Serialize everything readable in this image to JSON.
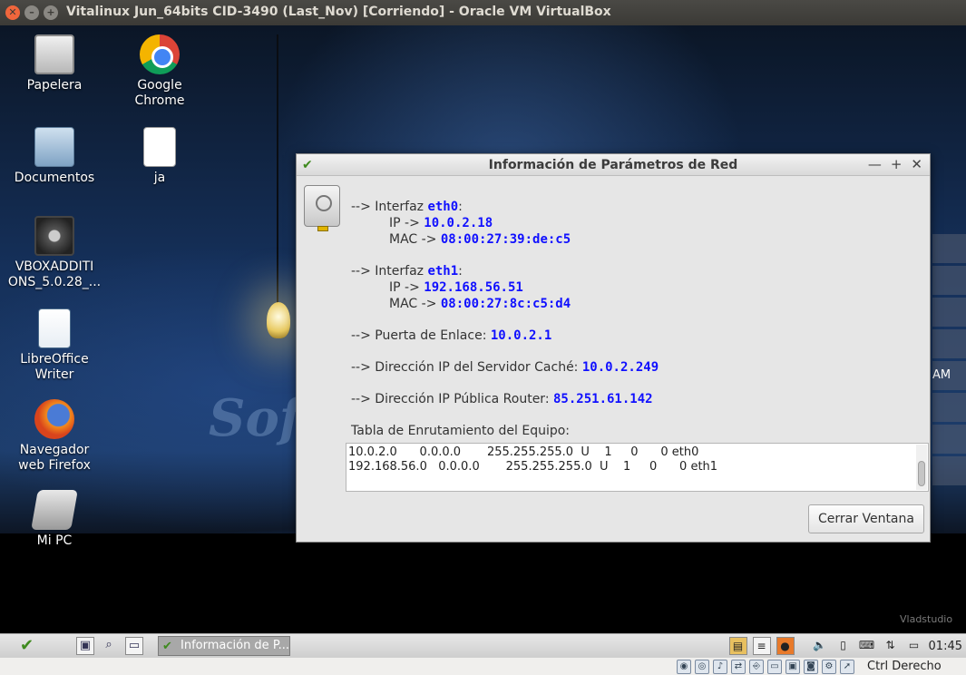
{
  "host_window": {
    "title": "Vitalinux Jun_64bits CID-3490 (Last_Nov) [Corriendo] - Oracle VM VirtualBox",
    "close_glyph": "✕",
    "min_glyph": "–",
    "max_glyph": "+"
  },
  "desktop": {
    "icons": [
      {
        "label": "Papelera",
        "icon": "trash-icon"
      },
      {
        "label": "Google\nChrome",
        "icon": "chrome-icon"
      },
      {
        "label": "Documentos",
        "icon": "folder-icon"
      },
      {
        "label": "ja",
        "icon": "text-file-icon"
      },
      {
        "label": "VBOXADDITI\nONS_5.0.28_...",
        "icon": "cd-icon"
      },
      {
        "label": "LibreOffice\nWriter",
        "icon": "writer-icon"
      },
      {
        "label": "Navegador\nweb Firefox",
        "icon": "firefox-icon"
      },
      {
        "label": "Mi PC",
        "icon": "computer-icon"
      }
    ],
    "partial_text": "AM",
    "wallpaper_credit": "Vladstudio",
    "wallpaper_text": "Softw"
  },
  "dialog": {
    "title": "Información de Parámetros de Red",
    "controls": {
      "minimize": "—",
      "maximize": "+",
      "close": "✕"
    },
    "eth0": {
      "prefix": "--> Interfaz ",
      "name": "eth0",
      "suffix": ":",
      "ip_label": "IP -> ",
      "ip": "10.0.2.18",
      "mac_label": "MAC -> ",
      "mac": "08:00:27:39:de:c5"
    },
    "eth1": {
      "prefix": "--> Interfaz ",
      "name": "eth1",
      "suffix": ":",
      "ip_label": "IP -> ",
      "ip": "192.168.56.51",
      "mac_label": "MAC -> ",
      "mac": "08:00:27:8c:c5:d4"
    },
    "gateway": {
      "label": "--> Puerta de Enlace: ",
      "value": "10.0.2.1"
    },
    "cache": {
      "label": "--> Dirección IP del Servidor Caché: ",
      "value": "10.0.2.249"
    },
    "public_ip": {
      "label": "--> Dirección IP Pública Router: ",
      "value": "85.251.61.142"
    },
    "route_table_label": "Tabla de Enrutamiento del Equipo:",
    "route_rows": [
      "10.0.2.0      0.0.0.0       255.255.255.0  U    1     0      0 eth0",
      "192.168.56.0   0.0.0.0       255.255.255.0  U    1     0      0 eth1"
    ],
    "close_button": "Cerrar Ventana"
  },
  "taskbar": {
    "task_label": "Información de P...",
    "clock": "01:45"
  },
  "host_status": {
    "host_key": "Ctrl Derecho"
  }
}
